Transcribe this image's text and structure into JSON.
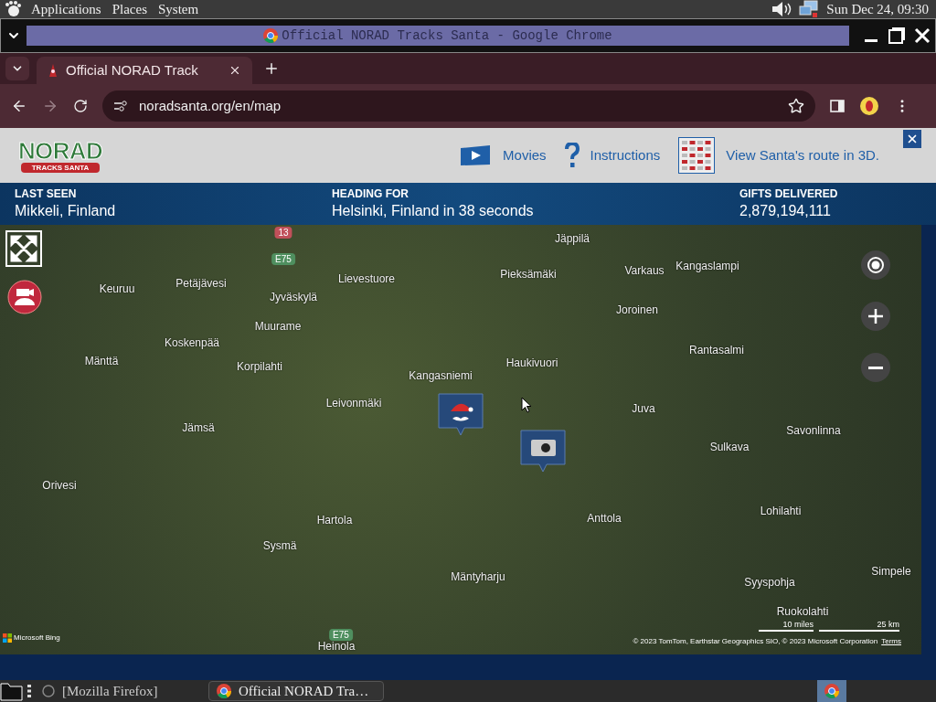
{
  "top_panel": {
    "menus": [
      "Applications",
      "Places",
      "System"
    ],
    "clock": "Sun Dec 24, 09:30"
  },
  "window": {
    "title": "Official NORAD Tracks Santa - Google Chrome"
  },
  "browser": {
    "tabs": [
      {
        "title": "Official NORAD Track",
        "selected": true
      }
    ],
    "url": "noradsanta.org/en/map"
  },
  "page": {
    "logo": {
      "title": "NORAD",
      "subtitle": "TRACKS SANTA"
    },
    "nav": [
      {
        "label": "Movies",
        "kind": "movies"
      },
      {
        "label": "Instructions",
        "kind": "instructions"
      },
      {
        "label": "View Santa's route in 3D.",
        "kind": "route3d"
      }
    ],
    "stats": [
      {
        "label": "LAST SEEN",
        "value": "Mikkeli, Finland"
      },
      {
        "label": "HEADING FOR",
        "value": "Helsinki, Finland in 38 seconds"
      },
      {
        "label": "GIFTS DELIVERED",
        "value": "2,879,194,111"
      }
    ],
    "map": {
      "places": [
        "Jäppilä",
        "Pieksämäki",
        "Varkaus",
        "Kangaslampi",
        "Keuruu",
        "Petäjävesi",
        "Jyväskylä",
        "Lievestuore",
        "Muurame",
        "Joroinen",
        "Koskenpää",
        "Mänttä",
        "Korpilahti",
        "Rantasalmi",
        "Haukivuori",
        "Kangasniemi",
        "Leivonmäki",
        "Juva",
        "Jämsä",
        "Savonlinna",
        "Sulkava",
        "Orivesi",
        "Anttola",
        "Lohilahti",
        "Hartola",
        "Sysmä",
        "Mäntyharju",
        "Syyspohja",
        "Simpele",
        "Ruokolahti",
        "Heinola"
      ],
      "roads": [
        "13",
        "E75",
        "E75"
      ],
      "scale": [
        "10 miles",
        "25 km"
      ],
      "brand": "Microsoft Bing",
      "attribution": "© 2023 TomTom, Earthstar Geographics SIO, © 2023 Microsoft Corporation",
      "terms": "Terms"
    }
  },
  "taskbar": {
    "items": [
      {
        "label": "[Mozilla Firefox]",
        "selected": false
      },
      {
        "label": "Official NORAD Tra…",
        "selected": true
      }
    ]
  }
}
